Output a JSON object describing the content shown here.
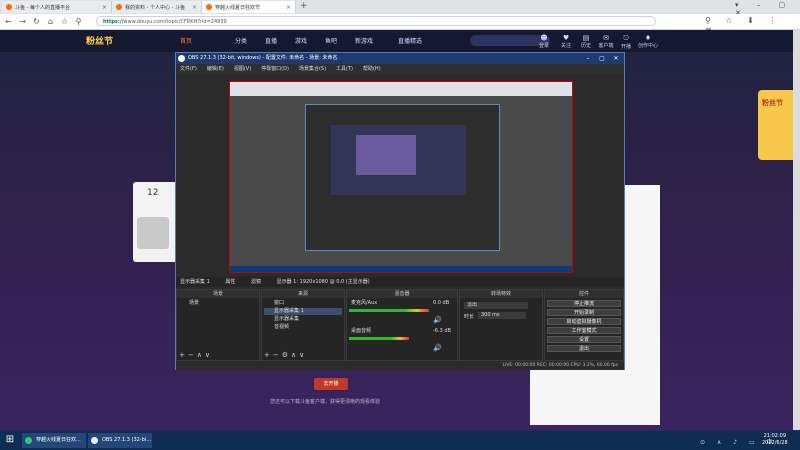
{
  "browser": {
    "tabs": [
      {
        "label": "斗鱼 - 每个人的直播平台",
        "active": false
      },
      {
        "label": "我的资料 - 个人中心 - 斗鱼",
        "active": false
      },
      {
        "label": "穿越火线夏日狂欢节",
        "active": true
      }
    ],
    "url_prefix": "https://",
    "url_rest": "www.douyu.com/topic/CFRKH?rid=24939"
  },
  "site": {
    "logo": "粉丝节",
    "nav": [
      "首页",
      "分类",
      "直播",
      "游戏",
      "鱼吧",
      "新游戏",
      "直播精选"
    ],
    "topicons": [
      {
        "icon": "☻",
        "label": "登录"
      },
      {
        "icon": "♥",
        "label": "关注"
      },
      {
        "icon": "▤",
        "label": "历史"
      },
      {
        "icon": "✉",
        "label": "客户端"
      },
      {
        "icon": "⎋",
        "label": "开播"
      },
      {
        "icon": "♦",
        "label": "创作中心"
      }
    ],
    "side_number": "12",
    "rank_label": "粉丝节",
    "below_button": "去开播",
    "below_text": "您还可以下载斗鱼客户端，获得更清晰的观看体验"
  },
  "obs": {
    "title": "OBS 27.1.3 (32-bit, windows) - 配置文件: 未命名 - 场景: 未命名",
    "menu": [
      "文件(F)",
      "编辑(E)",
      "视图(V)",
      "停靠窗口(D)",
      "场景集合(S)",
      "工具(T)",
      "帮助(H)"
    ],
    "preview_bar": [
      "显示器采集 1",
      "属性",
      "滤镜",
      "显示器 1: 1920x1080 @ 0,0 (主显示器)"
    ],
    "docks": {
      "scenes": {
        "title": "场景",
        "items": [
          "场景"
        ]
      },
      "sources": {
        "title": "来源",
        "items": [
          "窗口",
          "显示器采集 1",
          "显示器采集",
          "音视频"
        ]
      },
      "mixer": {
        "title": "混音器",
        "channels": [
          {
            "name": "麦克风/Aux",
            "db": "0.0 dB"
          },
          {
            "name": "桌面音频",
            "db": "-6.3 dB"
          }
        ]
      },
      "transitions": {
        "title": "转场特效",
        "type": "淡出",
        "duration_label": "时长",
        "duration": "300 ms"
      },
      "controls": {
        "title": "控件",
        "buttons": [
          "停止推流",
          "开始录制",
          "启动虚拟摄像机",
          "工作室模式",
          "设置",
          "退出"
        ]
      }
    },
    "status": "LIVE: 00:00:00   REC: 00:00:00   CPU: 3.2%, 60.00 fps"
  },
  "taskbar": {
    "items": [
      {
        "label": "穿越火线夏日狂欢..."
      },
      {
        "label": "OBS 27.1.3 (32-bi..."
      }
    ],
    "time": "21:02:09",
    "date": "2022/6/28"
  }
}
